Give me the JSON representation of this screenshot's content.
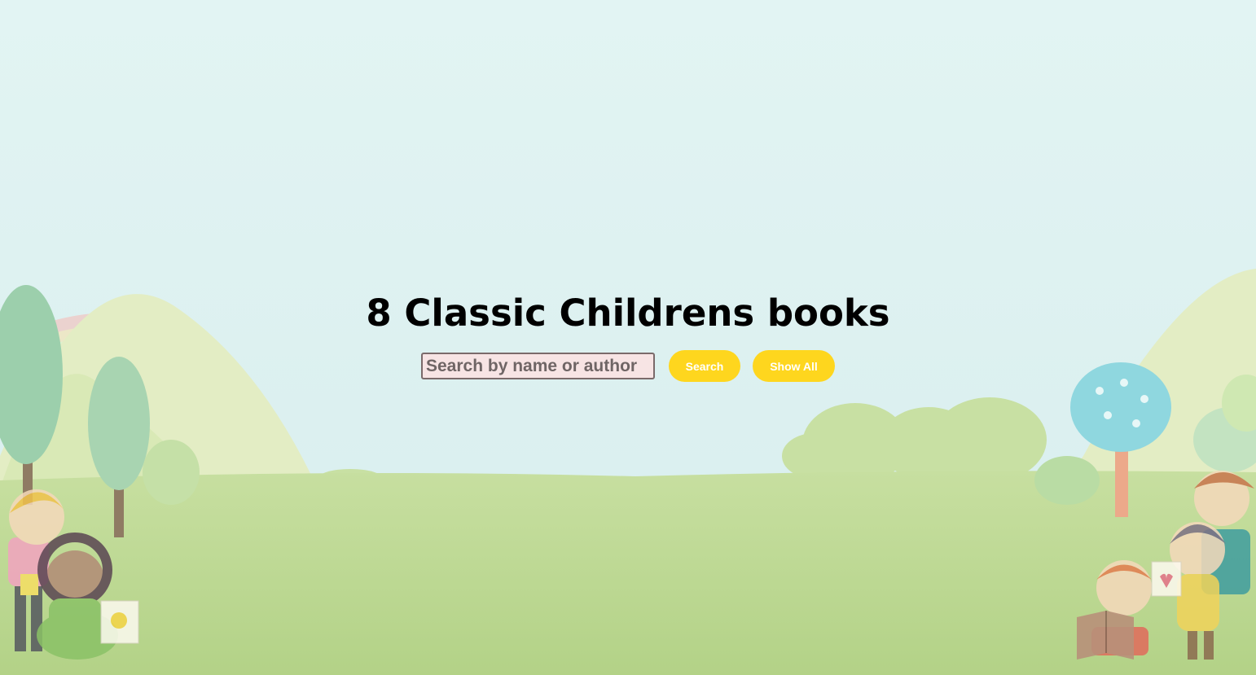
{
  "page": {
    "title": "8 Classic Childrens books"
  },
  "search": {
    "placeholder": "Search by name or author",
    "value": "",
    "search_label": "Search",
    "show_all_label": "Show All"
  },
  "colors": {
    "sky": "#e2f3f3",
    "grass": "#b9d68e",
    "button": "#fed61e",
    "button_text": "#ffffff",
    "input_bg": "#f7e4e4"
  },
  "background": {
    "icons": [
      "rainbow-icon",
      "hill-icon",
      "tree-icon",
      "bush-icon",
      "child-icon",
      "book-icon",
      "drawing-icon"
    ]
  }
}
